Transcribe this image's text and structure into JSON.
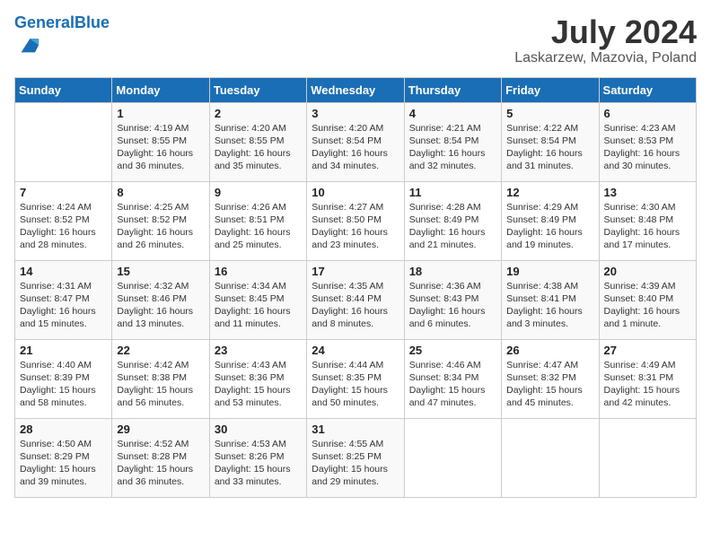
{
  "header": {
    "logo_general": "General",
    "logo_blue": "Blue",
    "month_title": "July 2024",
    "location": "Laskarzew, Mazovia, Poland"
  },
  "days_of_week": [
    "Sunday",
    "Monday",
    "Tuesday",
    "Wednesday",
    "Thursday",
    "Friday",
    "Saturday"
  ],
  "weeks": [
    [
      {
        "day": "",
        "sunrise": "",
        "sunset": "",
        "daylight": ""
      },
      {
        "day": "1",
        "sunrise": "Sunrise: 4:19 AM",
        "sunset": "Sunset: 8:55 PM",
        "daylight": "Daylight: 16 hours and 36 minutes."
      },
      {
        "day": "2",
        "sunrise": "Sunrise: 4:20 AM",
        "sunset": "Sunset: 8:55 PM",
        "daylight": "Daylight: 16 hours and 35 minutes."
      },
      {
        "day": "3",
        "sunrise": "Sunrise: 4:20 AM",
        "sunset": "Sunset: 8:54 PM",
        "daylight": "Daylight: 16 hours and 34 minutes."
      },
      {
        "day": "4",
        "sunrise": "Sunrise: 4:21 AM",
        "sunset": "Sunset: 8:54 PM",
        "daylight": "Daylight: 16 hours and 32 minutes."
      },
      {
        "day": "5",
        "sunrise": "Sunrise: 4:22 AM",
        "sunset": "Sunset: 8:54 PM",
        "daylight": "Daylight: 16 hours and 31 minutes."
      },
      {
        "day": "6",
        "sunrise": "Sunrise: 4:23 AM",
        "sunset": "Sunset: 8:53 PM",
        "daylight": "Daylight: 16 hours and 30 minutes."
      }
    ],
    [
      {
        "day": "7",
        "sunrise": "Sunrise: 4:24 AM",
        "sunset": "Sunset: 8:52 PM",
        "daylight": "Daylight: 16 hours and 28 minutes."
      },
      {
        "day": "8",
        "sunrise": "Sunrise: 4:25 AM",
        "sunset": "Sunset: 8:52 PM",
        "daylight": "Daylight: 16 hours and 26 minutes."
      },
      {
        "day": "9",
        "sunrise": "Sunrise: 4:26 AM",
        "sunset": "Sunset: 8:51 PM",
        "daylight": "Daylight: 16 hours and 25 minutes."
      },
      {
        "day": "10",
        "sunrise": "Sunrise: 4:27 AM",
        "sunset": "Sunset: 8:50 PM",
        "daylight": "Daylight: 16 hours and 23 minutes."
      },
      {
        "day": "11",
        "sunrise": "Sunrise: 4:28 AM",
        "sunset": "Sunset: 8:49 PM",
        "daylight": "Daylight: 16 hours and 21 minutes."
      },
      {
        "day": "12",
        "sunrise": "Sunrise: 4:29 AM",
        "sunset": "Sunset: 8:49 PM",
        "daylight": "Daylight: 16 hours and 19 minutes."
      },
      {
        "day": "13",
        "sunrise": "Sunrise: 4:30 AM",
        "sunset": "Sunset: 8:48 PM",
        "daylight": "Daylight: 16 hours and 17 minutes."
      }
    ],
    [
      {
        "day": "14",
        "sunrise": "Sunrise: 4:31 AM",
        "sunset": "Sunset: 8:47 PM",
        "daylight": "Daylight: 16 hours and 15 minutes."
      },
      {
        "day": "15",
        "sunrise": "Sunrise: 4:32 AM",
        "sunset": "Sunset: 8:46 PM",
        "daylight": "Daylight: 16 hours and 13 minutes."
      },
      {
        "day": "16",
        "sunrise": "Sunrise: 4:34 AM",
        "sunset": "Sunset: 8:45 PM",
        "daylight": "Daylight: 16 hours and 11 minutes."
      },
      {
        "day": "17",
        "sunrise": "Sunrise: 4:35 AM",
        "sunset": "Sunset: 8:44 PM",
        "daylight": "Daylight: 16 hours and 8 minutes."
      },
      {
        "day": "18",
        "sunrise": "Sunrise: 4:36 AM",
        "sunset": "Sunset: 8:43 PM",
        "daylight": "Daylight: 16 hours and 6 minutes."
      },
      {
        "day": "19",
        "sunrise": "Sunrise: 4:38 AM",
        "sunset": "Sunset: 8:41 PM",
        "daylight": "Daylight: 16 hours and 3 minutes."
      },
      {
        "day": "20",
        "sunrise": "Sunrise: 4:39 AM",
        "sunset": "Sunset: 8:40 PM",
        "daylight": "Daylight: 16 hours and 1 minute."
      }
    ],
    [
      {
        "day": "21",
        "sunrise": "Sunrise: 4:40 AM",
        "sunset": "Sunset: 8:39 PM",
        "daylight": "Daylight: 15 hours and 58 minutes."
      },
      {
        "day": "22",
        "sunrise": "Sunrise: 4:42 AM",
        "sunset": "Sunset: 8:38 PM",
        "daylight": "Daylight: 15 hours and 56 minutes."
      },
      {
        "day": "23",
        "sunrise": "Sunrise: 4:43 AM",
        "sunset": "Sunset: 8:36 PM",
        "daylight": "Daylight: 15 hours and 53 minutes."
      },
      {
        "day": "24",
        "sunrise": "Sunrise: 4:44 AM",
        "sunset": "Sunset: 8:35 PM",
        "daylight": "Daylight: 15 hours and 50 minutes."
      },
      {
        "day": "25",
        "sunrise": "Sunrise: 4:46 AM",
        "sunset": "Sunset: 8:34 PM",
        "daylight": "Daylight: 15 hours and 47 minutes."
      },
      {
        "day": "26",
        "sunrise": "Sunrise: 4:47 AM",
        "sunset": "Sunset: 8:32 PM",
        "daylight": "Daylight: 15 hours and 45 minutes."
      },
      {
        "day": "27",
        "sunrise": "Sunrise: 4:49 AM",
        "sunset": "Sunset: 8:31 PM",
        "daylight": "Daylight: 15 hours and 42 minutes."
      }
    ],
    [
      {
        "day": "28",
        "sunrise": "Sunrise: 4:50 AM",
        "sunset": "Sunset: 8:29 PM",
        "daylight": "Daylight: 15 hours and 39 minutes."
      },
      {
        "day": "29",
        "sunrise": "Sunrise: 4:52 AM",
        "sunset": "Sunset: 8:28 PM",
        "daylight": "Daylight: 15 hours and 36 minutes."
      },
      {
        "day": "30",
        "sunrise": "Sunrise: 4:53 AM",
        "sunset": "Sunset: 8:26 PM",
        "daylight": "Daylight: 15 hours and 33 minutes."
      },
      {
        "day": "31",
        "sunrise": "Sunrise: 4:55 AM",
        "sunset": "Sunset: 8:25 PM",
        "daylight": "Daylight: 15 hours and 29 minutes."
      },
      {
        "day": "",
        "sunrise": "",
        "sunset": "",
        "daylight": ""
      },
      {
        "day": "",
        "sunrise": "",
        "sunset": "",
        "daylight": ""
      },
      {
        "day": "",
        "sunrise": "",
        "sunset": "",
        "daylight": ""
      }
    ]
  ]
}
